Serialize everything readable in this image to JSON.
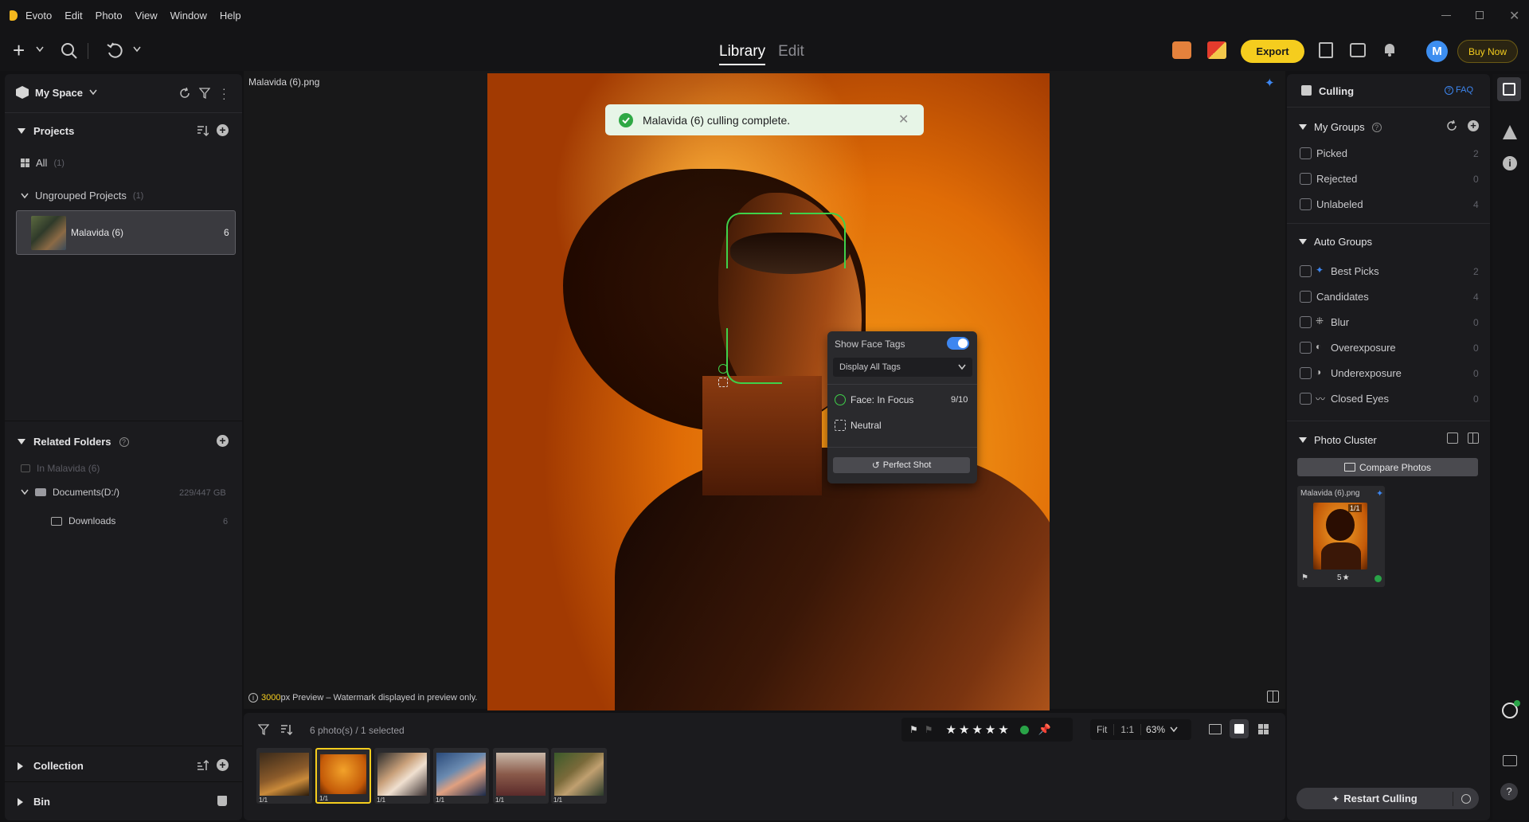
{
  "app": {
    "name": "Evoto"
  },
  "menu": [
    "Edit",
    "Photo",
    "View",
    "Window",
    "Help"
  ],
  "topbar": {
    "tabs": [
      {
        "label": "Library",
        "active": true
      },
      {
        "label": "Edit",
        "active": false
      }
    ],
    "export_label": "Export",
    "buy_label": "Buy Now",
    "avatar_letter": "M"
  },
  "left": {
    "space_title": "My Space",
    "projects": {
      "title": "Projects",
      "all_label": "All",
      "all_count": "(1)",
      "group_label": "Ungrouped Projects",
      "group_count": "(1)",
      "project_name": "Malavida (6)",
      "project_count": "6"
    },
    "related": {
      "title": "Related Folders",
      "in_label": "In Malavida (6)",
      "drive_label": "Documents(D:/)",
      "drive_size": "229/447 GB",
      "folder_label": "Downloads",
      "folder_count": "6"
    },
    "collection_label": "Collection",
    "bin_label": "Bin"
  },
  "center": {
    "filename": "Malavida (6).png",
    "toast": "Malavida (6) culling complete.",
    "preview_res": "3000",
    "preview_note": "px Preview – Watermark displayed in preview only.",
    "popup": {
      "show_tags": "Show Face Tags",
      "toggle_on": true,
      "display_select": "Display All Tags",
      "face_focus_label": "Face: In Focus",
      "face_focus_score": "9/10",
      "neutral_label": "Neutral",
      "perfect_label": "Perfect Shot"
    }
  },
  "filmstrip": {
    "summary": "6 photo(s) / 1 selected",
    "rating": 5,
    "zoom_fit": "Fit",
    "zoom_1": "1:1",
    "zoom_pct": "63%",
    "thumbs": [
      {
        "badge": "1/1"
      },
      {
        "badge": "1/1",
        "selected": true
      },
      {
        "badge": "1/1"
      },
      {
        "badge": "1/1"
      },
      {
        "badge": "1/1"
      },
      {
        "badge": "1/1"
      }
    ]
  },
  "right": {
    "title": "Culling",
    "faq": "FAQ",
    "my_groups": {
      "title": "My Groups",
      "items": [
        {
          "label": "Picked",
          "count": "2"
        },
        {
          "label": "Rejected",
          "count": "0"
        },
        {
          "label": "Unlabeled",
          "count": "4"
        }
      ]
    },
    "auto_groups": {
      "title": "Auto Groups",
      "items": [
        {
          "label": "Best Picks",
          "count": "2"
        },
        {
          "label": "Candidates",
          "count": "4"
        },
        {
          "label": "Blur",
          "count": "0"
        },
        {
          "label": "Overexposure",
          "count": "0"
        },
        {
          "label": "Underexposure",
          "count": "0"
        },
        {
          "label": "Closed Eyes",
          "count": "0"
        }
      ]
    },
    "cluster": {
      "title": "Photo Cluster",
      "compare": "Compare Photos",
      "card_name": "Malavida (6).png",
      "card_badge": "1/1",
      "card_rating": "5"
    },
    "restart": "Restart Culling"
  },
  "colors": {
    "accent_yellow": "#f5cd1e",
    "toggle_blue": "#3d86f0",
    "face_box": "#3fd14a",
    "toast_bg": "#e7f5e7"
  }
}
